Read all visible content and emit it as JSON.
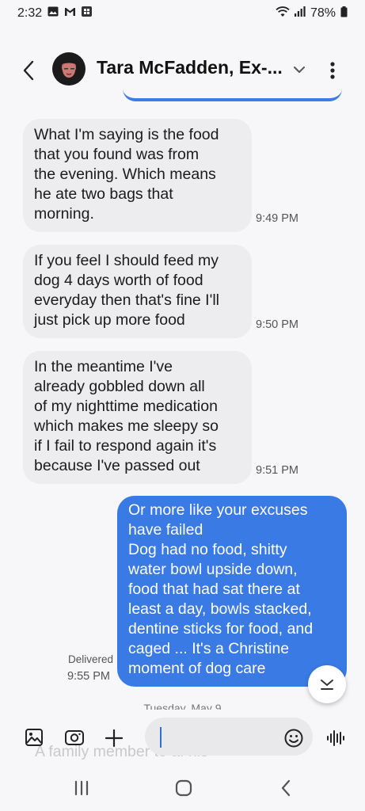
{
  "status_bar": {
    "time": "2:32",
    "battery": "78%"
  },
  "header": {
    "contact_name": "Tara McFadden, Ex-..."
  },
  "messages": [
    {
      "direction": "incoming",
      "lines": [
        "What I'm saying is the food",
        "that you found was from",
        "the evening. Which means",
        "he ate two bags that",
        "morning."
      ],
      "time": "9:49 PM"
    },
    {
      "direction": "incoming",
      "lines": [
        "If you feel I should feed my",
        "dog 4 days worth of food",
        "everyday then that's fine I'll",
        "just pick up more food"
      ],
      "time": "9:50 PM"
    },
    {
      "direction": "incoming",
      "lines": [
        "In the meantime I've",
        "already gobbled down all",
        "of my nighttime medication",
        "which makes me sleepy so",
        "if I fail to respond again it's",
        "because I've passed out"
      ],
      "time": "9:51 PM"
    },
    {
      "direction": "outgoing",
      "lines": [
        "Or more like your excuses",
        "have failed",
        "Dog had no food, shitty",
        "water  bowl upside down,",
        "food that had sat there at",
        "least a day, bowls stacked,",
        "dentine sticks for food, and",
        "caged ... It's a Christine",
        "moment of dog care"
      ],
      "status": "Delivered",
      "time": "9:55 PM"
    }
  ],
  "date_separator": "Tuesday, May 9",
  "next_message_preview": "A family member to a. his",
  "composer": {
    "input_value": "",
    "placeholder": ""
  },
  "colors": {
    "outgoing_bubble": "#3a7ae4",
    "incoming_bubble": "#ededef",
    "background": "#f7f7f9"
  }
}
